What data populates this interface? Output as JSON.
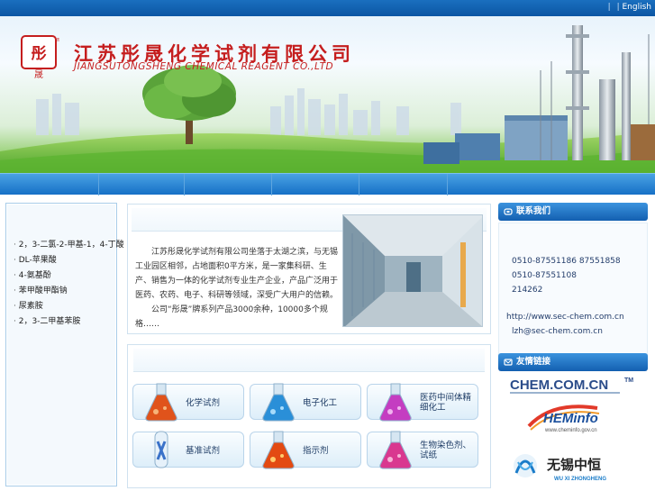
{
  "topbar": {
    "separator": "|",
    "english_label": "English"
  },
  "header": {
    "company_cn": "江苏彤晟化学试剂有限公司",
    "company_en": "JIANGSUTONGSHENG CHEMICAL REAGENT CO.,LTD"
  },
  "nav": {
    "items": [
      "",
      "",
      "",
      "",
      "",
      ""
    ]
  },
  "products": {
    "items": [
      "2，3-二氯-2-甲基-1，4-丁酸",
      "DL-苹果酸",
      "4-氨基酚",
      "苯甲酸甲酯钠",
      "尿素胺",
      "2，3-二甲基苯胺"
    ]
  },
  "intro": {
    "para1": "江苏彤晟化学试剂有限公司坐落于太湖之滨，与无锡工业园区相邻，占地面积0平方米，是一家集科研、生产、销售为一体的化学试剂专业生产企业，产品广泛用于医药、农药、电子、科研等领域，深受广大用户的信赖。",
    "para2": "公司“彤晟”牌系列产品3000余种，10000多个规格……"
  },
  "categories": [
    {
      "label": "化学试剂",
      "color": "#e0531b"
    },
    {
      "label": "电子化工",
      "color": "#2a8fd8"
    },
    {
      "label": "医药中间体精细化工",
      "color": "#c43dc1"
    },
    {
      "label": "基准试剂",
      "color": "#3a72c9"
    },
    {
      "label": "指示剂",
      "color": "#e34a12"
    },
    {
      "label": "生物染色剂、试纸",
      "color": "#d9388f"
    }
  ],
  "sidebar": {
    "contact_title": "联系我们",
    "phone1": "0510-87551186 87551858",
    "phone2": "0510-87551108",
    "fax": "214262",
    "website": "http://www.sec-chem.com.cn",
    "email": "lzh@sec-chem.com.cn",
    "links_title": "友情链接",
    "link_logos": {
      "chem_text": "CHEM.COM.CN",
      "chem_tm": "TM",
      "heminfo_text": "HEMinfo",
      "heminfo_sub": "www.cheminfo.gov.cn",
      "wuxi_cn": "无锡中恒",
      "wuxi_en": "WU XI ZHONGHENG"
    }
  },
  "colors": {
    "accent": "#1670c6",
    "brand_red": "#c51e1e"
  }
}
